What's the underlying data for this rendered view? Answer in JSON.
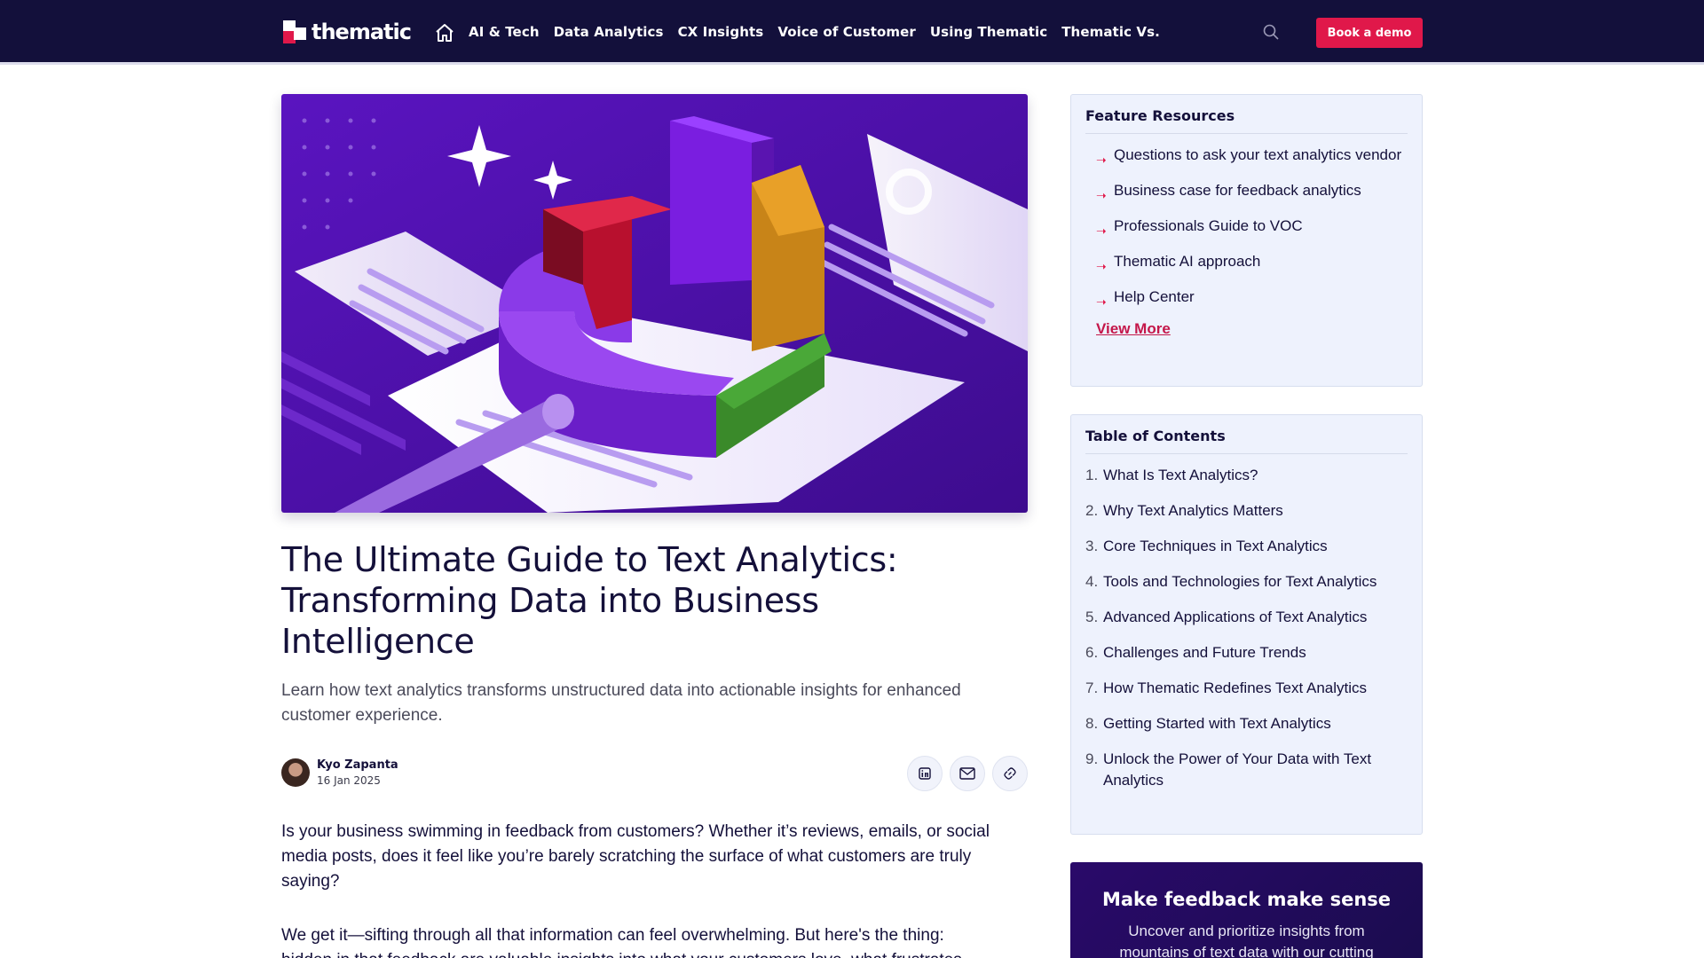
{
  "nav": {
    "logo": "thematic",
    "links": [
      "AI & Tech",
      "Data Analytics",
      "CX Insights",
      "Voice of Customer",
      "Using Thematic",
      "Thematic Vs."
    ],
    "cta": "Book a demo",
    "icons": [
      "home-icon",
      "search-icon"
    ]
  },
  "article": {
    "title": "The Ultimate Guide to Text Analytics: Transforming Data into Business Intelligence",
    "subtitle": "Learn how text analytics transforms unstructured data into actionable insights for enhanced customer experience.",
    "author": "Kyo Zapanta",
    "date": "16 Jan 2025",
    "share_icons": [
      "linkedin-icon",
      "email-icon",
      "link-icon"
    ],
    "p1": "Is your business swimming in feedback from customers? Whether it’s reviews, emails, or social media posts, does it feel like you’re barely scratching the surface of what customers are truly saying?",
    "p2": "We get it—sifting through all that information can feel overwhelming. But here's the thing:",
    "p3": "hidden in that feedback are valuable insights into what your customers love, what frustrates"
  },
  "sidebar": {
    "resources_title": "Feature Resources",
    "resources": [
      "Questions to ask your text analytics vendor",
      "Business case for feedback analytics",
      "Professionals Guide to VOC",
      "Thematic AI approach",
      "Help Center"
    ],
    "view_more": "View More",
    "toc_title": "Table of Contents",
    "toc": [
      "What Is Text Analytics?",
      "Why Text Analytics Matters",
      "Core Techniques in Text Analytics",
      "Tools and Technologies for Text Analytics",
      "Advanced Applications of Text Analytics",
      "Challenges and Future Trends",
      "How Thematic Redefines Text Analytics",
      "Getting Started with Text Analytics",
      "Unlock the Power of Your Data with Text Analytics"
    ],
    "toc_numbers": [
      "1.",
      "2.",
      "3.",
      "4.",
      "5.",
      "6.",
      "7.",
      "8.",
      "9."
    ],
    "promo_title": "Make feedback make sense",
    "promo_text": "Uncover and prioritize insights from mountains of text data with our cutting"
  },
  "colors": {
    "nav_bg": "#13103b",
    "accent": "#e0184a",
    "card_bg": "#eef2fd",
    "hero_bg": "#4a0fa8"
  }
}
